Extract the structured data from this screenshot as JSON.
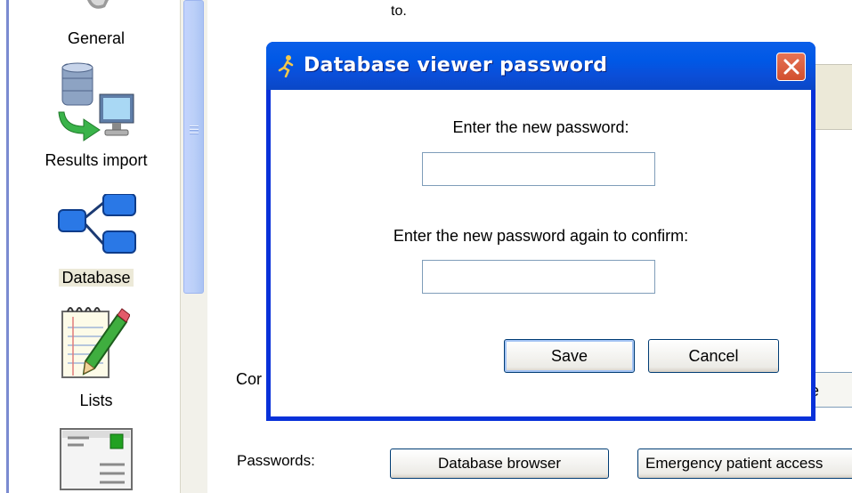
{
  "sidebar": {
    "items": [
      {
        "label": "General",
        "icon": "general-settings-icon"
      },
      {
        "label": "Results import",
        "icon": "database-import-icon"
      },
      {
        "label": "Database",
        "icon": "database-tree-icon",
        "selected": true
      },
      {
        "label": "Lists",
        "icon": "notepad-pencil-icon"
      },
      {
        "label": "",
        "icon": "document-card-icon"
      }
    ]
  },
  "background": {
    "to_label": "to.",
    "cor_label": "Cor",
    "partial_button_label": "e",
    "passwords_label": "Passwords:",
    "database_browser_button": "Database browser",
    "emergency_button": "Emergency patient access"
  },
  "dialog": {
    "title": "Database viewer password",
    "prompt_new": "Enter the new password:",
    "prompt_confirm": "Enter the new password again to confirm:",
    "new_password_value": "",
    "confirm_password_value": "",
    "save_label": "Save",
    "cancel_label": "Cancel"
  },
  "colors": {
    "titlebar": "#0058e6",
    "close_button": "#d24f2e",
    "selected_nav_bg": "#ece9d8"
  }
}
